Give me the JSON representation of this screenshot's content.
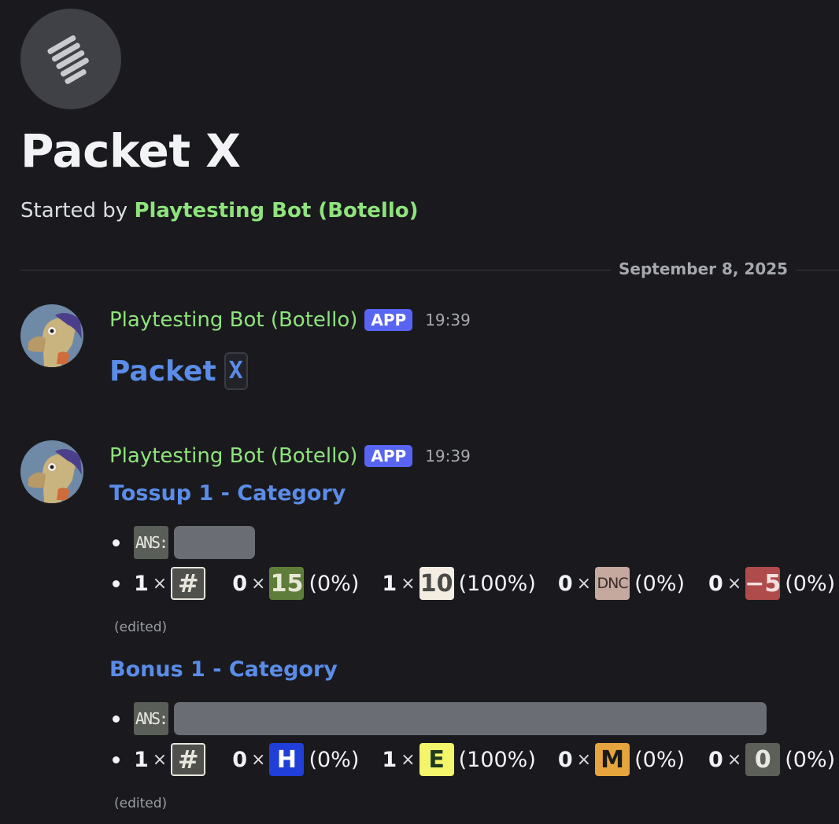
{
  "thread": {
    "title": "Packet X",
    "started_by_prefix": "Started by ",
    "started_by_name": "Playtesting Bot (Botello)"
  },
  "divider_date": "September 8, 2025",
  "messages": [
    {
      "author": "Playtesting Bot (Botello)",
      "app_tag": "APP",
      "time": "19:39",
      "heading": "Packet",
      "heading_code": "X"
    },
    {
      "author": "Playtesting Bot (Botello)",
      "app_tag": "APP",
      "time": "19:39",
      "tossup": {
        "title": "Tossup 1 - Category",
        "ans_label": "ANS:",
        "stats": {
          "hash_count": "1",
          "hash_glyph": "#",
          "items": [
            {
              "count": "0",
              "label": "15",
              "pct": "(0%)",
              "bg": "#5f7d3a",
              "fg": "#e8e8d8"
            },
            {
              "count": "1",
              "label": "10",
              "pct": "(100%)",
              "bg": "#f3ede2",
              "fg": "#4a4a46"
            },
            {
              "count": "0",
              "label": "DNC",
              "pct": "(0%)",
              "bg": "#c5a89e",
              "fg": "#3a2e2a"
            },
            {
              "count": "0",
              "label": "−5",
              "pct": "(0%)",
              "bg": "#b04b4b",
              "fg": "#f5e0e0"
            }
          ]
        },
        "edited": "(edited)"
      },
      "bonus": {
        "title": "Bonus 1 - Category",
        "ans_label": "ANS:",
        "stats": {
          "hash_count": "1",
          "hash_glyph": "#",
          "items": [
            {
              "count": "0",
              "label": "H",
              "pct": "(0%)",
              "bg": "#1f3fd8",
              "fg": "#ffffff"
            },
            {
              "count": "1",
              "label": "E",
              "pct": "(100%)",
              "bg": "#f4f56a",
              "fg": "#1e3a1e"
            },
            {
              "count": "0",
              "label": "M",
              "pct": "(0%)",
              "bg": "#e6a53c",
              "fg": "#1a1a1a"
            },
            {
              "count": "0",
              "label": "0",
              "pct": "(0%)",
              "bg": "#5c6059",
              "fg": "#e8e8e0"
            }
          ]
        },
        "edited": "(edited)"
      }
    }
  ],
  "icons": {
    "thread": "thread-icon",
    "avatar": "horse-avatar"
  }
}
